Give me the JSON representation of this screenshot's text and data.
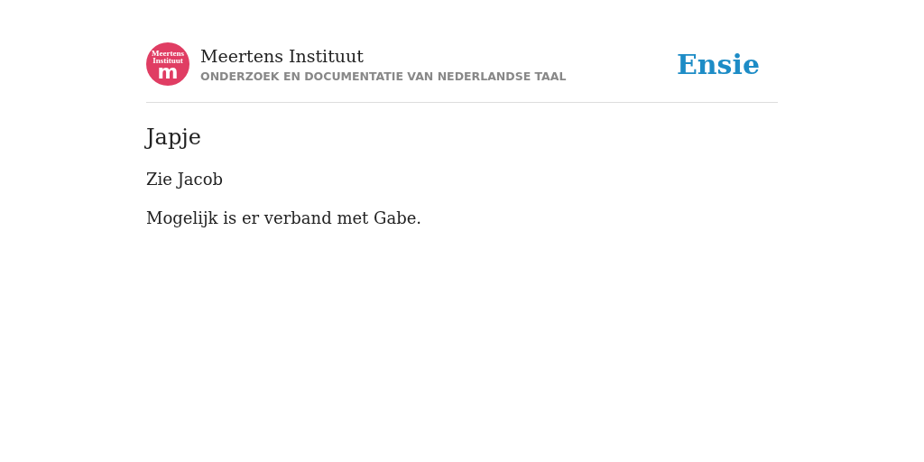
{
  "header": {
    "logo": {
      "lines": [
        "Meertens",
        "Instituut"
      ],
      "letter": "m"
    },
    "title": "Meertens Instituut",
    "subtitle": "ONDERZOEK EN DOCUMENTATIE VAN NEDERLANDSE TAAL",
    "brand": "Ensie"
  },
  "article": {
    "heading": "Japje",
    "paragraphs": [
      "Zie Jacob",
      "Mogelijk is er verband met Gabe."
    ]
  }
}
